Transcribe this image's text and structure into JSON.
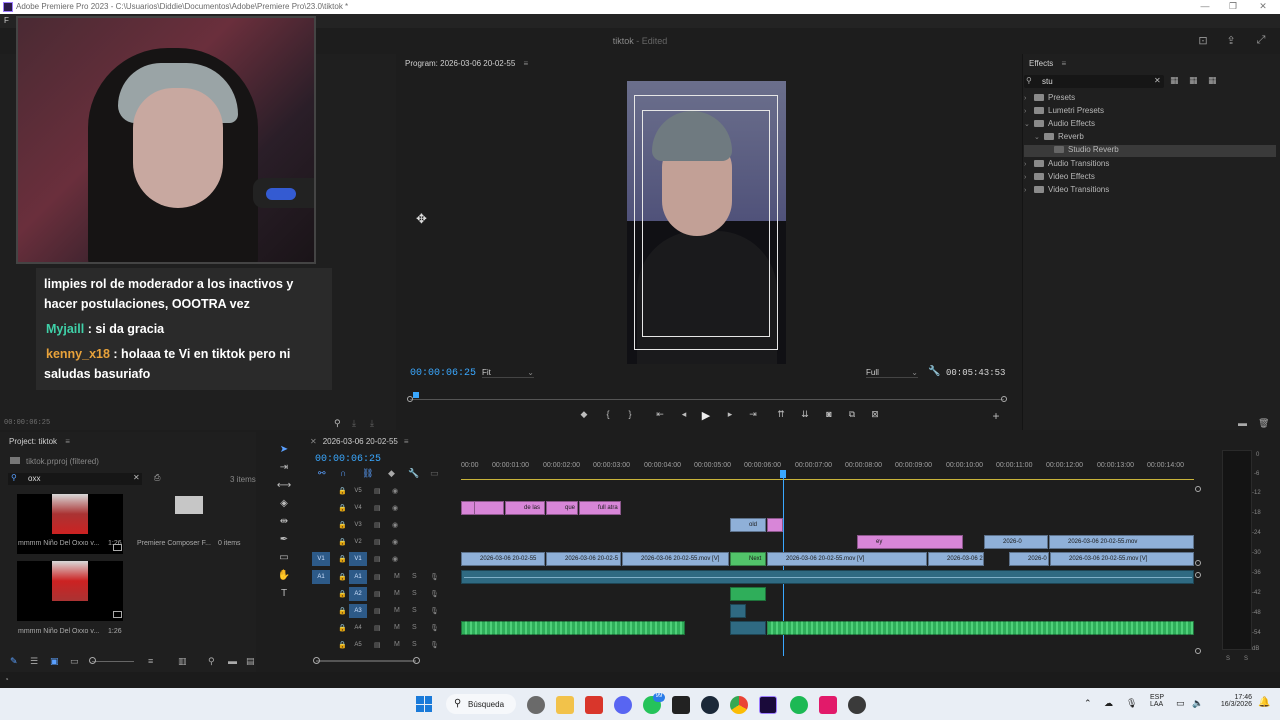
{
  "window": {
    "title": "Adobe Premiere Pro 2023 - C:\\Usuarios\\Diddie\\Documentos\\Adobe\\Premiere Pro\\23.0\\tiktok *",
    "menu_partial": "F"
  },
  "header": {
    "project_name": "tiktok",
    "status": "- Edited"
  },
  "chat": {
    "lines": [
      "limpies rol de moderador a los inactivos y",
      "hacer postulaciones, OOOTRA vez"
    ],
    "messages": [
      {
        "name": "Myjaill",
        "text": ": si da gracia",
        "color": "#3fd0a8"
      },
      {
        "name": "kenny_x18",
        "text": ": holaaa te Vi en tiktok pero ni",
        "color": "#e8a23a"
      }
    ],
    "continuation": "saludas basuriafo"
  },
  "source_timecode": "00:00:06:25",
  "program": {
    "label": "Program: 2026-03-06 20-02-55",
    "timecode": "00:00:06:25",
    "fit": "Fit",
    "quality": "Full",
    "duration": "00:05:43:53"
  },
  "effects": {
    "tab": "Effects",
    "search": "stu",
    "items": [
      {
        "label": "Presets",
        "level": 0,
        "open": false
      },
      {
        "label": "Lumetri Presets",
        "level": 0,
        "open": false
      },
      {
        "label": "Audio Effects",
        "level": 0,
        "open": true
      },
      {
        "label": "Reverb",
        "level": 1,
        "open": true
      },
      {
        "label": "Studio Reverb",
        "level": 2,
        "selected": true
      },
      {
        "label": "Audio Transitions",
        "level": 0,
        "open": false
      },
      {
        "label": "Video Effects",
        "level": 0,
        "open": false
      },
      {
        "label": "Video Transitions",
        "level": 0,
        "open": false
      }
    ]
  },
  "project": {
    "tab": "Project: tiktok",
    "file": "tiktok.prproj (filtered)",
    "search": "oxx",
    "count": "3 items",
    "items": [
      {
        "name": "mmmm Niño Del Oxxo v...",
        "duration": "1:26"
      },
      {
        "name": "Premiere Composer F...",
        "duration": "0 items"
      },
      {
        "name": "mmmm Niño Del Oxxo v...",
        "duration": "1:26"
      }
    ]
  },
  "timeline": {
    "tab": "2026-03-06 20-02-55",
    "timecode": "00:00:06:25",
    "ruler": [
      "00:00",
      "00:00:01:00",
      "00:00:02:00",
      "00:00:03:00",
      "00:00:04:00",
      "00:00:05:00",
      "00:00:06:00",
      "00:00:07:00",
      "00:00:08:00",
      "00:00:09:00",
      "00:00:10:00",
      "00:00:11:00",
      "00:00:12:00",
      "00:00:13:00",
      "00:00:14:00"
    ],
    "video_tracks": [
      "V5",
      "V4",
      "V3",
      "V2",
      "V1"
    ],
    "audio_tracks": [
      "A1",
      "A2",
      "A3",
      "A4",
      "A5"
    ],
    "source_v": "V1",
    "source_a": "A1",
    "mute_label": "M",
    "solo_label": "S",
    "clips": {
      "v4": [
        "de las",
        "que",
        "full atra"
      ],
      "v3": [
        "old"
      ],
      "v2": [
        "ey",
        "2026-0",
        "2026-03-06 20-02-55.mov"
      ],
      "v1": [
        "2026-03-06 20-02-55",
        "2026-03-06 20-02-5",
        "2026-03-06 20-02-55.mov [V]",
        "Next",
        "2026-03-06 20-02-55.mov [V]",
        "2026-03-06 2",
        "2026-0",
        "2026-03-06 20-02-55.mov [V]"
      ]
    }
  },
  "meter": {
    "labels": [
      "0",
      "-6",
      "-12",
      "-18",
      "-24",
      "-30",
      "-36",
      "-42",
      "-48",
      "-54",
      "dB"
    ],
    "solo": "S"
  },
  "taskbar": {
    "search": "Búsqueda",
    "lang1": "ESP",
    "lang2": "LAA",
    "time": "17:46",
    "date": "16/3/2026",
    "badge": "99"
  }
}
